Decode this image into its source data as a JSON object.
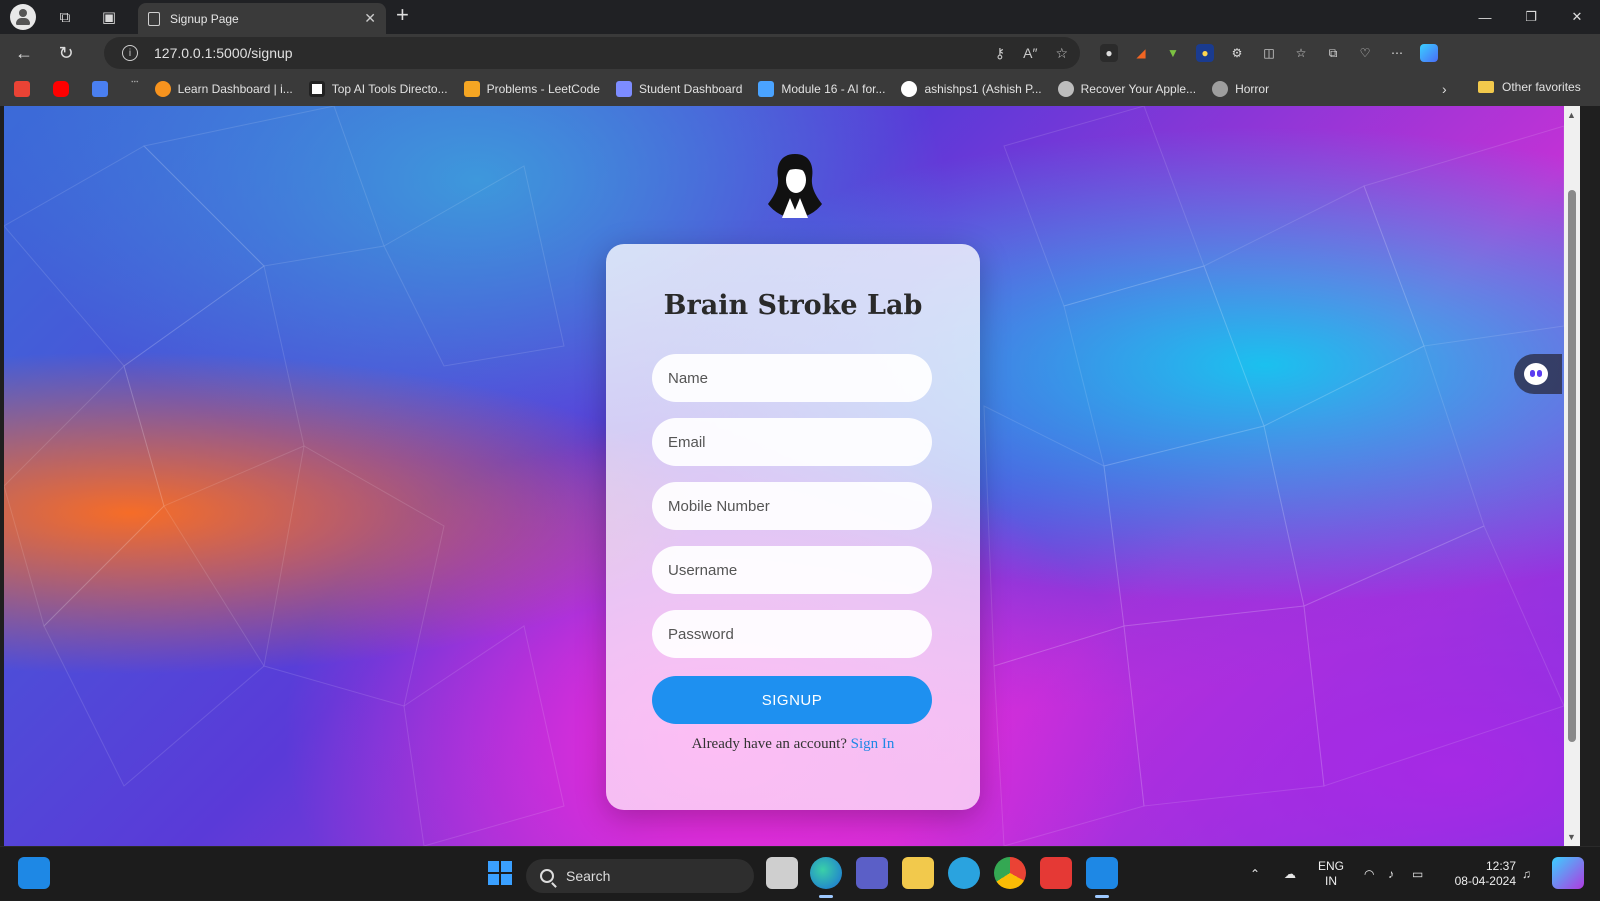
{
  "browser": {
    "tab_title": "Signup Page",
    "url": "127.0.0.1:5000/signup",
    "bookmarks": [
      {
        "label": "",
        "color": "#ea4335"
      },
      {
        "label": "",
        "color": "#ff0000"
      },
      {
        "label": "",
        "color": "#4a7ff0"
      },
      {
        "label": "་་་",
        "color": "#3a3a3a"
      },
      {
        "label": "Learn Dashboard | i...",
        "color": "#f7931e"
      },
      {
        "label": "Top AI Tools Directo...",
        "color": "#ffffff"
      },
      {
        "label": "Problems - LeetCode",
        "color": "#f5a623"
      },
      {
        "label": "Student Dashboard",
        "color": "#7d8cff"
      },
      {
        "label": "Module 16 - AI for...",
        "color": "#4aa3ff"
      },
      {
        "label": "ashishps1 (Ashish P...",
        "color": "#ffffff"
      },
      {
        "label": "Recover Your Apple...",
        "color": "#bdbdbd"
      },
      {
        "label": "Horror",
        "color": "#9e9e9e"
      }
    ],
    "other_favorites": "Other favorites"
  },
  "page": {
    "title": "Brain Stroke Lab",
    "fields": {
      "name": "Name",
      "email": "Email",
      "mobile": "Mobile Number",
      "username": "Username",
      "password": "Password"
    },
    "signup_label": "SIGNUP",
    "already_text": "Already have an account?",
    "signin_link": "Sign In"
  },
  "taskbar": {
    "search_label": "Search",
    "lang_line1": "ENG",
    "lang_line2": "IN",
    "time": "12:37",
    "date": "08-04-2024"
  },
  "colors": {
    "accent": "#1e90f0",
    "link": "#1e88e5"
  }
}
